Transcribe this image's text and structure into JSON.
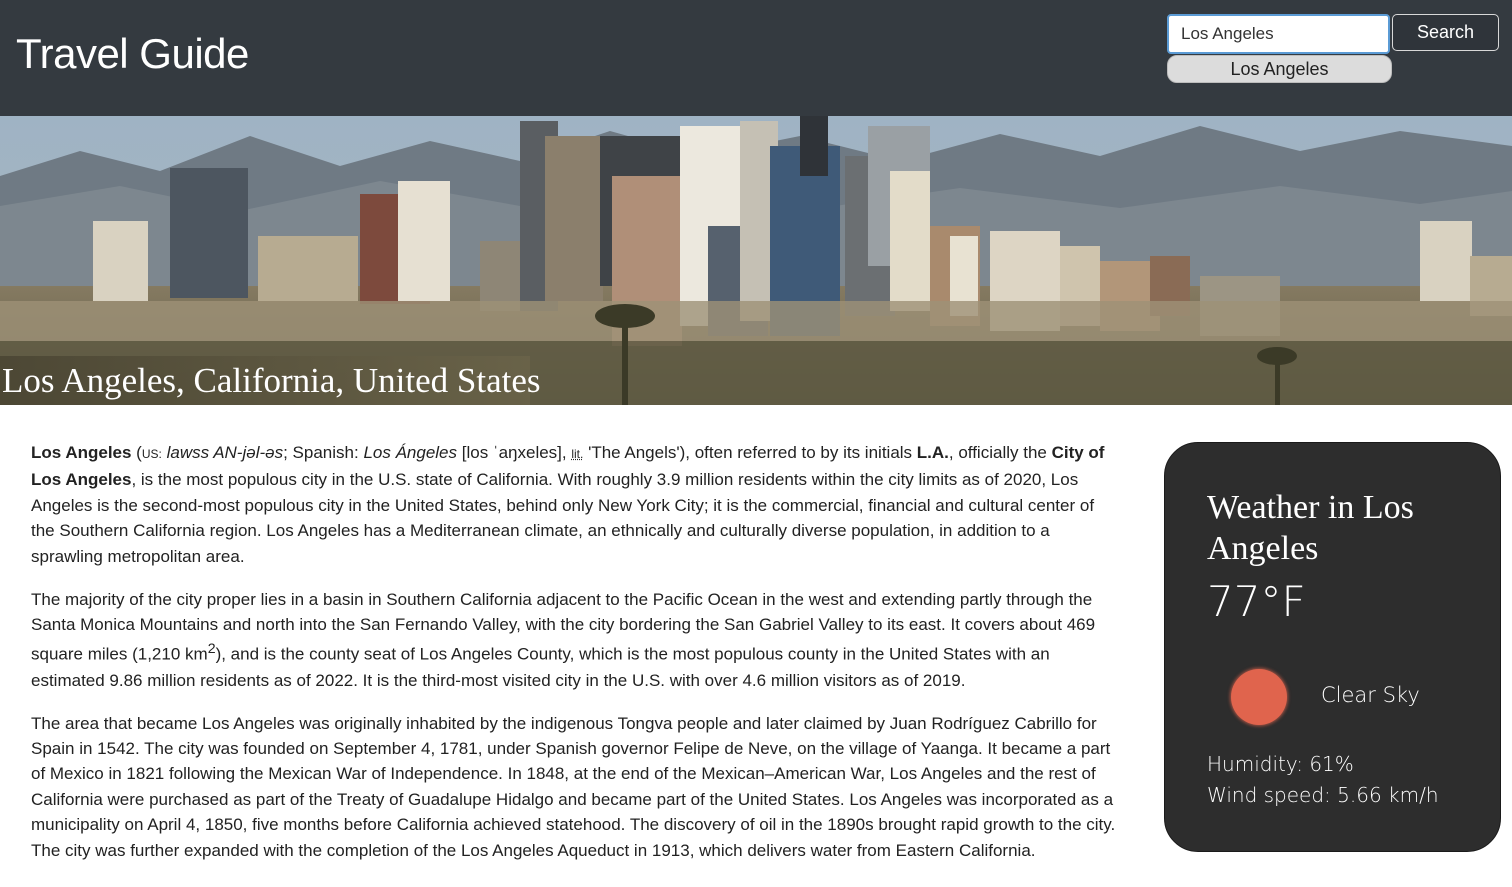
{
  "header": {
    "title": "Travel Guide",
    "search_value": "Los Angeles",
    "search_button": "Search",
    "suggestion": "Los Angeles"
  },
  "hero": {
    "caption": "Los Angeles, California, United States"
  },
  "article": {
    "p1": {
      "name": "Los Angeles",
      "us": "US:",
      "pron": "lawss AN-jəl-əs",
      "semi": "; Spanish: ",
      "spanish": "Los Ángeles",
      "ipa": " [los ˈaŋxeles], ",
      "lit": "lit.",
      "rest1": " 'The Angels'), often referred to by its initials ",
      "la": "L.A.",
      "rest2": ", officially the ",
      "city": "City of Los Angeles",
      "rest3": ", is the most populous city in the U.S. state of California. With roughly 3.9 million residents within the city limits as of 2020, Los Angeles is the second-most populous city in the United States, behind only New York City; it is the commercial, financial and cultural center of the Southern California region. Los Angeles has a Mediterranean climate, an ethnically and culturally diverse population, in addition to a sprawling metropolitan area."
    },
    "p2_a": "The majority of the city proper lies in a basin in Southern California adjacent to the Pacific Ocean in the west and extending partly through the Santa Monica Mountains and north into the San Fernando Valley, with the city bordering the San Gabriel Valley to its east. It covers about 469 square miles (1,210 km",
    "p2_sup": "2",
    "p2_b": "), and is the county seat of Los Angeles County, which is the most populous county in the United States with an estimated 9.86 million residents as of 2022. It is the third-most visited city in the U.S. with over 4.6 million visitors as of 2019.",
    "p3": "The area that became Los Angeles was originally inhabited by the indigenous Tongva people and later claimed by Juan Rodríguez Cabrillo for Spain in 1542. The city was founded on September 4, 1781, under Spanish governor Felipe de Neve, on the village of Yaanga. It became a part of Mexico in 1821 following the Mexican War of Independence. In 1848, at the end of the Mexican–American War, Los Angeles and the rest of California were purchased as part of the Treaty of Guadalupe Hidalgo and became part of the United States. Los Angeles was incorporated as a municipality on April 4, 1850, five months before California achieved statehood. The discovery of oil in the 1890s brought rapid growth to the city. The city was further expanded with the completion of the Los Angeles Aqueduct in 1913, which delivers water from Eastern California."
  },
  "weather": {
    "title": "Weather in Los Angeles",
    "temperature": "77°F",
    "icon": "sun-icon",
    "description": "Clear Sky",
    "humidity": "Humidity: 61%",
    "wind": "Wind speed: 5.66 km/h"
  },
  "colors": {
    "header_bg": "#343a40",
    "card_bg": "#2d2d2d",
    "sun": "#e0644d"
  }
}
